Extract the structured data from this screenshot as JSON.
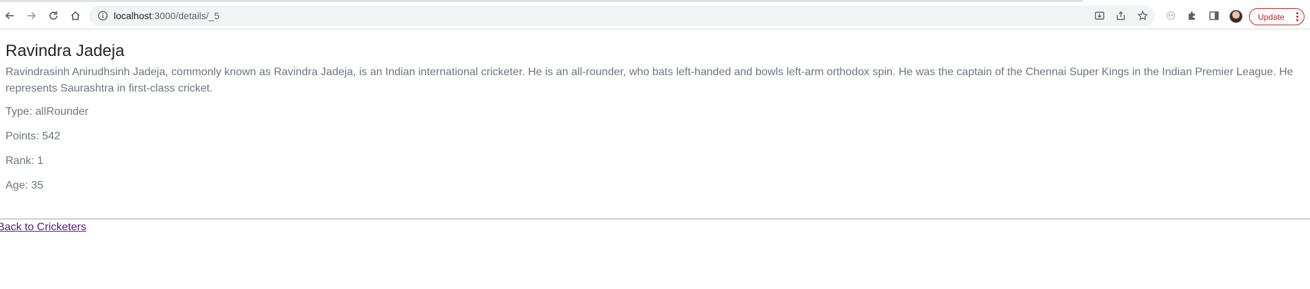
{
  "browser": {
    "url_host": "localhost",
    "url_path": ":3000/details/_5",
    "update_label": "Update",
    "icons": [
      "back-icon",
      "forward-icon",
      "reload-icon",
      "home-icon",
      "site-info-icon",
      "install-app-icon",
      "share-icon",
      "bookmark-star-icon",
      "extension-puzzle-icon",
      "side-panel-icon",
      "profile-avatar",
      "menu-dots-icon"
    ]
  },
  "details": {
    "name": "Ravindra Jadeja",
    "description": "Ravindrasinh Anirudhsinh Jadeja, commonly known as Ravindra Jadeja, is an Indian international cricketer. He is an all-rounder, who bats left-handed and bowls left-arm orthodox spin. He was the captain of the Chennai Super Kings in the Indian Premier League. He represents Saurashtra in first-class cricket.",
    "type": "Type: allRounder",
    "points": "Points: 542",
    "rank": "Rank: 1",
    "age": "Age: 35"
  },
  "footer": {
    "back_link": "Back to Cricketers"
  }
}
